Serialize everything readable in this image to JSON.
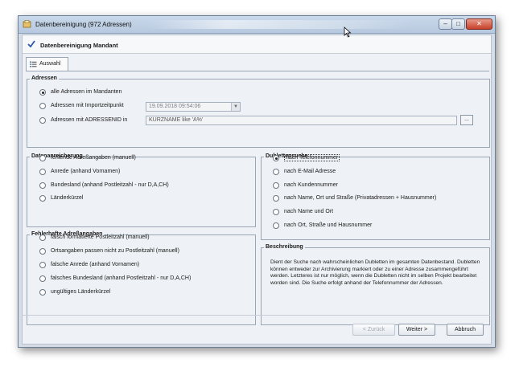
{
  "window": {
    "title": "Datenbereinigung (972 Adressen)",
    "buttons": {
      "minimize": "–",
      "maximize": "□",
      "close": "✕"
    }
  },
  "header": {
    "title": "Datenbereinigung Mandant"
  },
  "tabs": [
    {
      "label": "Auswahl",
      "active": true
    }
  ],
  "adressen": {
    "title": "Adressen",
    "options": [
      {
        "label": "alle Adressen im Mandanten",
        "checked": true
      },
      {
        "label": "Adressen mit Importzeitpunkt",
        "checked": false
      },
      {
        "label": "Adressen mit ADRESSENID in",
        "checked": false
      }
    ],
    "import_value": "19.09.2018 09:54:06",
    "id_filter_value": "KURZNAME like 'A%'",
    "browse_label": "..."
  },
  "datenanreicherung": {
    "title": "Datenanreicherung",
    "options": [
      {
        "label": "fehlende Adreßangaben (manuell)"
      },
      {
        "label": "Anrede (anhand Vornamen)"
      },
      {
        "label": "Bundesland (anhand Postleitzahl - nur D,A,CH)"
      },
      {
        "label": "Länderkürzel"
      }
    ]
  },
  "fehlerhafte": {
    "title": "Fehlerhafte Adreßangaben",
    "options": [
      {
        "label": "falsch formatierte Postleitzahl (manuell)"
      },
      {
        "label": "Ortsangaben passen nicht zu Postleitzahl (manuell)"
      },
      {
        "label": "falsche Anrede (anhand Vornamen)"
      },
      {
        "label": "falsches Bundesland (anhand Postleitzahl - nur D,A,CH)"
      },
      {
        "label": "ungültiges Länderkürzel"
      }
    ]
  },
  "dublettensuche": {
    "title": "Dublettensuche",
    "options": [
      {
        "label": "nach Telefonnummer",
        "checked": true
      },
      {
        "label": "nach E-Mail Adresse"
      },
      {
        "label": "nach Kundennummer"
      },
      {
        "label": "nach Name, Ort und Straße (Privatadressen + Hausnummer)"
      },
      {
        "label": "nach Name und Ort"
      },
      {
        "label": "nach Ort, Straße und Hausnummer"
      }
    ]
  },
  "beschreibung": {
    "title": "Beschreibung",
    "text": "Dient der Suche nach wahrscheinlichen Dubletten im gesamten Datenbestand. Dubletten können entweder zur Archivierung markiert oder zu einer Adresse zusammengeführt werden. Letzteres ist nur möglich, wenn die Dubletten nicht im selben Projekt bearbeitet worden sind. Die Suche erfolgt anhand der Telefonnummer der Adressen."
  },
  "footer": {
    "back_label": "< Zurück",
    "next_label": "Weiter >",
    "cancel_label": "Abbruch"
  }
}
